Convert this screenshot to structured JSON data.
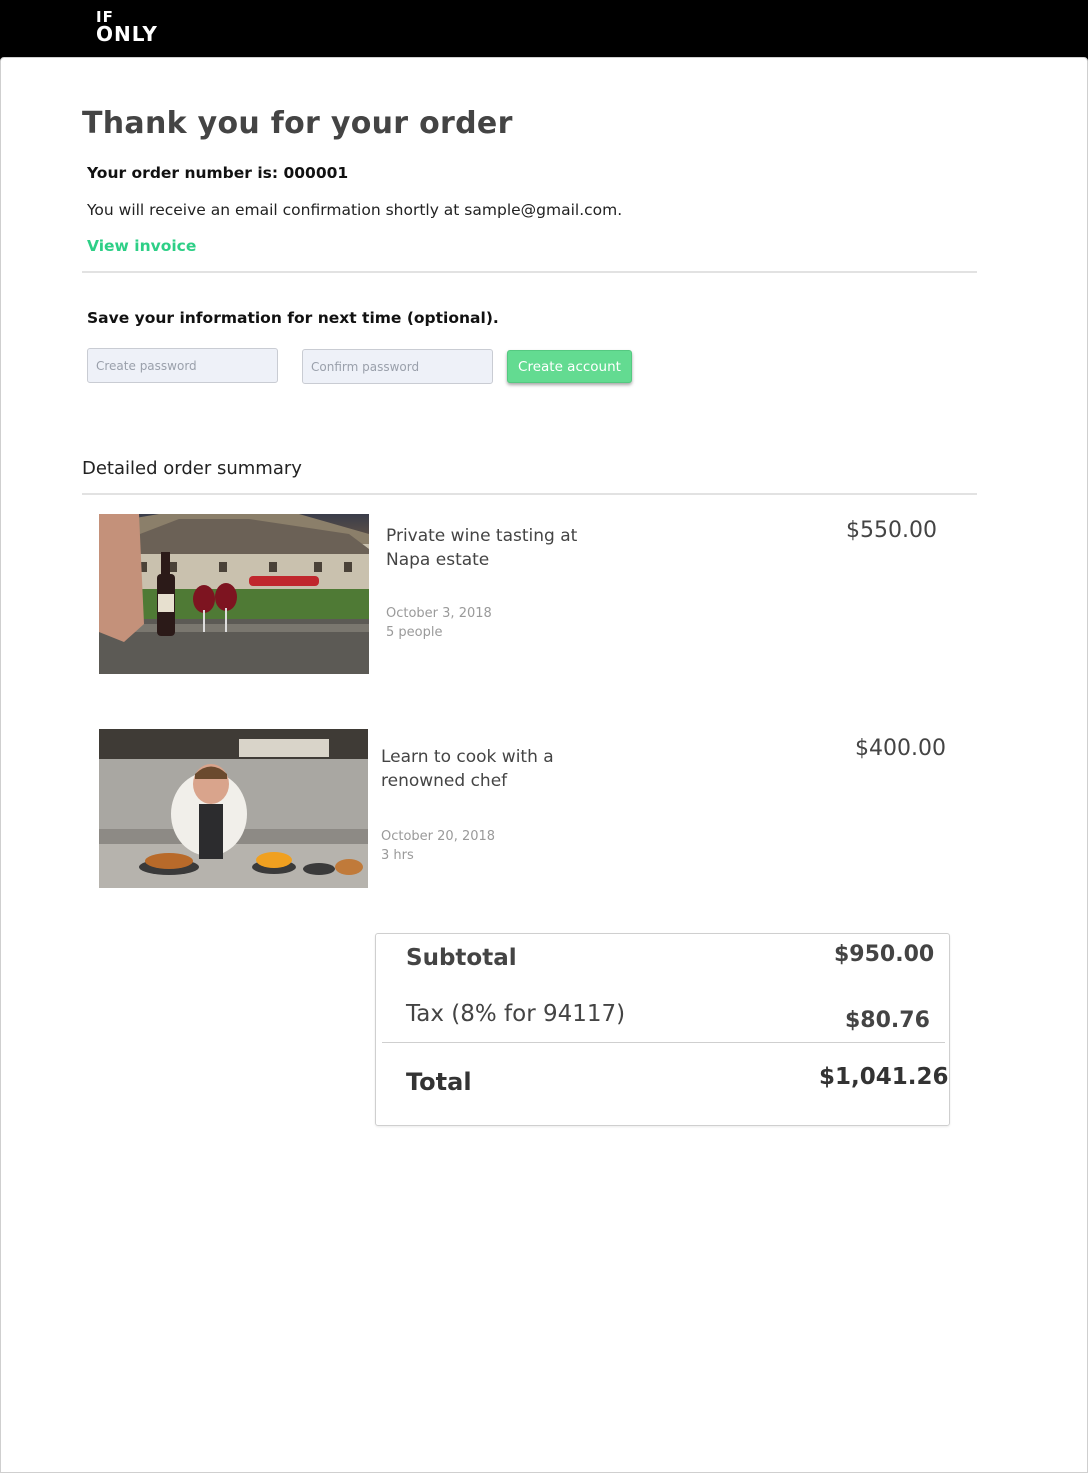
{
  "brand": {
    "logo_line1": "IF",
    "logo_line2": "ONLY"
  },
  "confirmation": {
    "title": "Thank you for your order",
    "order_number_text": "Your order number is: 000001",
    "email_text": "You will receive an email confirmation shortly at sample@gmail.com.",
    "view_invoice_label": "View invoice"
  },
  "account": {
    "prompt": "Save your information for next time (optional).",
    "password_placeholder": "Create password",
    "confirm_placeholder": "Confirm password",
    "create_button_label": "Create account"
  },
  "summary": {
    "heading": "Detailed order summary",
    "items": [
      {
        "title": "Private wine tasting at Napa estate",
        "date": "October 3, 2018",
        "detail": "5 people",
        "price": "$550.00"
      },
      {
        "title": "Learn to cook with a renowned chef",
        "date": "October 20, 2018",
        "detail": "3 hrs",
        "price": "$400.00"
      }
    ]
  },
  "totals": {
    "subtotal_label": "Subtotal",
    "subtotal_value": "$950.00",
    "tax_label": "Tax (8% for 94117)",
    "tax_value": "$80.76",
    "total_label": "Total",
    "total_value": "$1,041.26"
  },
  "colors": {
    "accent_green": "#2dcf86",
    "button_green": "#63db91",
    "topbar": "#000000"
  }
}
